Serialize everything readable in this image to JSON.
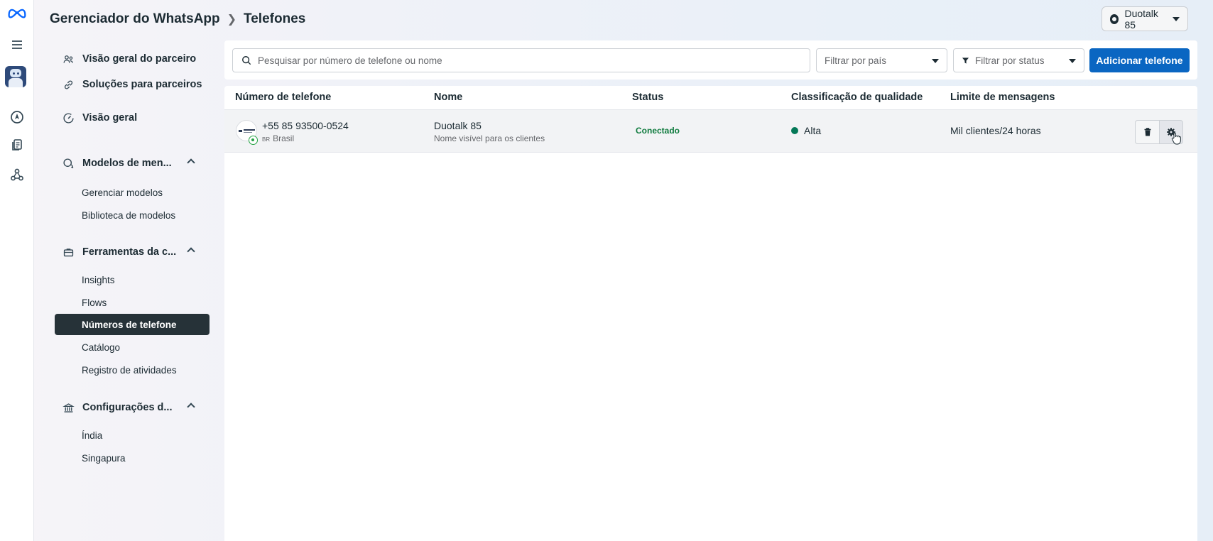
{
  "header": {
    "app_title": "Gerenciador do WhatsApp",
    "page_title": "Telefones",
    "account_label": "Duotalk 85"
  },
  "rail": {
    "icons": [
      "meta-logo-icon",
      "menu-icon",
      "avatar",
      "compass-icon",
      "documents-icon",
      "integrations-icon"
    ]
  },
  "sidebar": {
    "items": [
      {
        "label": "Visão geral do parceiro",
        "icon": "partners-icon"
      },
      {
        "label": "Soluções para parceiros",
        "icon": "link-icon"
      },
      {
        "label": "Visão geral",
        "icon": "gauge-icon"
      },
      {
        "label": "Modelos de men...",
        "icon": "chat-bubbles-icon",
        "expanded": true
      },
      {
        "label": "Ferramentas da c...",
        "icon": "briefcase-icon",
        "expanded": true
      },
      {
        "label": "Configurações d...",
        "icon": "bank-icon",
        "expanded": true
      }
    ],
    "templates_sub": [
      "Gerenciar modelos",
      "Biblioteca de modelos"
    ],
    "tools_sub": [
      "Insights",
      "Flows",
      "Números de telefone",
      "Catálogo",
      "Registro de atividades"
    ],
    "settings_sub": [
      "Índia",
      "Singapura"
    ],
    "active": "Números de telefone"
  },
  "filters": {
    "search_placeholder": "Pesquisar por número de telefone ou nome",
    "country_placeholder": "Filtrar por país",
    "status_placeholder": "Filtrar por status",
    "add_button": "Adicionar telefone"
  },
  "table": {
    "columns": [
      "Número de telefone",
      "Nome",
      "Status",
      "Classificação de qualidade",
      "Limite de mensagens"
    ],
    "rows": [
      {
        "phone": "+55 85 93500-0524",
        "country_code": "BR",
        "country": "Brasil",
        "name": "Duotalk 85",
        "name_sub": "Nome visível para os clientes",
        "status": "Conectado",
        "quality": "Alta",
        "quality_color": "#047857",
        "limit": "Mil clientes/24 horas"
      }
    ]
  },
  "colors": {
    "primary": "#0a66c2",
    "active_nav": "#263238",
    "connected": "#0e7a3d"
  }
}
